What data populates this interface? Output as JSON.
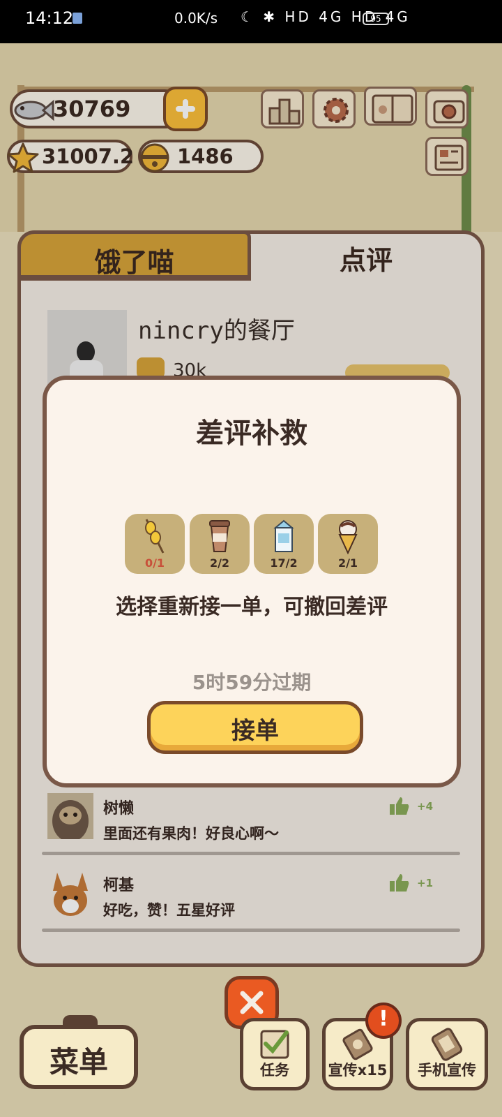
{
  "status_bar": {
    "time": "14:12",
    "net_speed": "0.0K/s",
    "indicators": "☾ ✱ HD 4G HD 4G",
    "battery": "95"
  },
  "currency": {
    "fish": "30769",
    "star": "31007.2",
    "bell": "1486"
  },
  "panel": {
    "tab_left": "饿了喵",
    "tab_right": "点评",
    "restaurant_name": "nincry的餐厅",
    "likes_partial": "30k"
  },
  "modal": {
    "title": "差评补救",
    "items": [
      {
        "icon": "sausage-skewer-icon",
        "count": "0/1",
        "insufficient": true
      },
      {
        "icon": "coffee-cup-icon",
        "count": "2/2",
        "insufficient": false
      },
      {
        "icon": "milk-carton-icon",
        "count": "17/2",
        "insufficient": false
      },
      {
        "icon": "ice-cream-cone-icon",
        "count": "2/1",
        "insufficient": false
      }
    ],
    "description": "选择重新接一单，可撤回差评",
    "expire": "5时59分过期",
    "accept_label": "接单"
  },
  "reviews": [
    {
      "name": "树懒",
      "text": "里面还有果肉！好良心啊～",
      "points": "+4"
    },
    {
      "name": "柯基",
      "text": "好吃，赞！五星好评",
      "points": "+1"
    }
  ],
  "bottom_bar": {
    "menu": "菜单",
    "task": "任务",
    "promo": "宣传x15",
    "phone_promo": "手机宣传",
    "alert": "!"
  },
  "colors": {
    "accent_gold": "#d6a33a",
    "button_yellow": "#fdd35a",
    "close_orange": "#ea5a22",
    "outline_brown": "#7a5848",
    "thumb_green": "#8aab5a",
    "warn_red": "#c8503a"
  }
}
